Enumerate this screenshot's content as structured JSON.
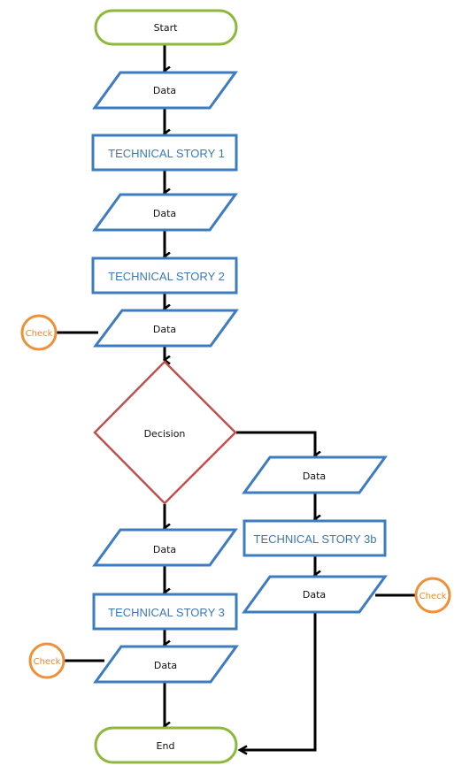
{
  "diagram": {
    "type": "flowchart",
    "colors": {
      "terminator": "#8db83c",
      "data": "#3d7cc0",
      "process": "#3d7cc0",
      "process_text": "#3a78b8",
      "decision": "#c0504d",
      "check": "#f0913a",
      "check_text": "#e8862a",
      "connector": "#000000"
    },
    "nodes": {
      "start": {
        "label": "Start",
        "kind": "terminator"
      },
      "data1": {
        "label": "Data",
        "kind": "data"
      },
      "ts1": {
        "label": "TECHNICAL STORY 1",
        "kind": "process"
      },
      "data2": {
        "label": "Data",
        "kind": "data"
      },
      "ts2": {
        "label": "TECHNICAL STORY 2",
        "kind": "process"
      },
      "data3": {
        "label": "Data",
        "kind": "data"
      },
      "check1": {
        "label": "Check",
        "kind": "check"
      },
      "decision": {
        "label": "Decision",
        "kind": "decision"
      },
      "data_left": {
        "label": "Data",
        "kind": "data"
      },
      "ts3": {
        "label": "TECHNICAL STORY 3",
        "kind": "process"
      },
      "data_left2": {
        "label": "Data",
        "kind": "data"
      },
      "check3": {
        "label": "Check",
        "kind": "check"
      },
      "data_right": {
        "label": "Data",
        "kind": "data"
      },
      "ts3b": {
        "label": "TECHNICAL STORY 3b",
        "kind": "process"
      },
      "data_right2": {
        "label": "Data",
        "kind": "data"
      },
      "check2": {
        "label": "Check",
        "kind": "check"
      },
      "end": {
        "label": "End",
        "kind": "terminator"
      }
    },
    "edges": [
      {
        "from": "start",
        "to": "data1",
        "arrow": true
      },
      {
        "from": "data1",
        "to": "ts1",
        "arrow": true
      },
      {
        "from": "ts1",
        "to": "data2",
        "arrow": true
      },
      {
        "from": "data2",
        "to": "ts2",
        "arrow": true
      },
      {
        "from": "ts2",
        "to": "data3",
        "arrow": true
      },
      {
        "from": "check1",
        "to": "data3",
        "arrow": false
      },
      {
        "from": "data3",
        "to": "decision",
        "arrow": true
      },
      {
        "from": "decision",
        "to": "data_left",
        "arrow": true
      },
      {
        "from": "decision",
        "to": "data_right",
        "arrow": true
      },
      {
        "from": "data_left",
        "to": "ts3",
        "arrow": true
      },
      {
        "from": "ts3",
        "to": "data_left2",
        "arrow": true
      },
      {
        "from": "check3",
        "to": "data_left2",
        "arrow": false
      },
      {
        "from": "data_left2",
        "to": "end",
        "arrow": true
      },
      {
        "from": "data_right",
        "to": "ts3b",
        "arrow": true
      },
      {
        "from": "ts3b",
        "to": "data_right2",
        "arrow": true
      },
      {
        "from": "data_right2",
        "to": "check2",
        "arrow": false
      },
      {
        "from": "data_right2",
        "to": "end",
        "arrow": true
      }
    ]
  }
}
